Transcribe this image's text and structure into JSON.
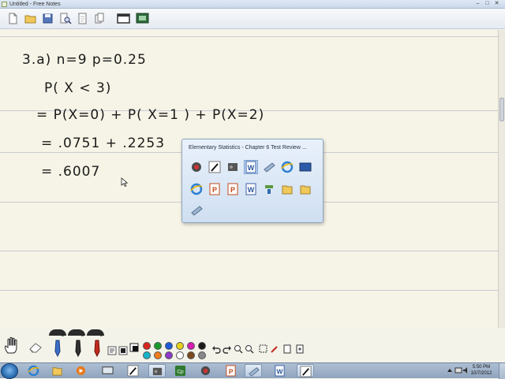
{
  "window": {
    "title": "Untitled - Free Notes",
    "minimize": "–",
    "maximize": "□",
    "close": "✕"
  },
  "toolbar": {
    "buttons": [
      "new-file",
      "open-folder",
      "save",
      "print-preview",
      "clear",
      "copy",
      "present-window",
      "screen-capture"
    ]
  },
  "notes": {
    "line1": "3.a) n=9   p=0.25",
    "line2": "P( X < 3)",
    "line3": "= P(X=0)  +  P( X=1 )  +  P(X=2)",
    "line4": "= .0751  +  .2253",
    "line5": "= .6007"
  },
  "jumplist": {
    "title": "Elementary Statistics - Chapter 6 Test Review ..."
  },
  "pen_toolbar": {
    "pen_numbers": [
      "2",
      "2",
      "2"
    ],
    "colors": [
      "#d8261c",
      "#1a9a2c",
      "#1c5ad8",
      "#e6d21a",
      "#d81cb4",
      "#16b4c8",
      "#1a1a1a"
    ]
  },
  "taskbar": {
    "clock_time": "5:50 PM",
    "clock_date": "10/7/2012"
  }
}
